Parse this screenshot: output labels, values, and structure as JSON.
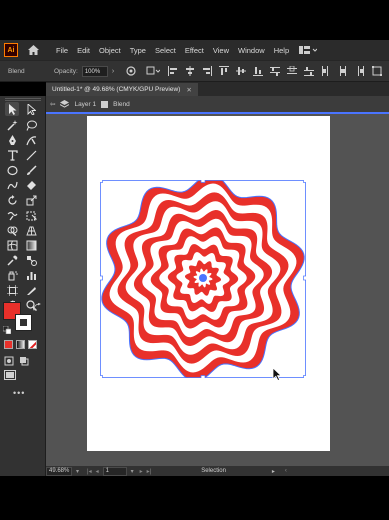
{
  "app": {
    "logo_text": "Ai"
  },
  "menu": [
    "File",
    "Edit",
    "Object",
    "Type",
    "Select",
    "Effect",
    "View",
    "Window",
    "Help"
  ],
  "control_bar": {
    "selection_type": "Blend",
    "opacity_label": "Opacity:",
    "opacity_value": "100%"
  },
  "document": {
    "tab_title": "Untitled-1* @ 49.68% (CMYK/GPU Preview)",
    "breadcrumb": [
      "Layer 1",
      "Blend"
    ]
  },
  "status": {
    "zoom": "49.68%",
    "artboard_number": "1",
    "mode": "Selection"
  },
  "colors": {
    "fill": "#e8302a",
    "stroke": "#ffffff",
    "selection": "#4a74ff",
    "app_bg": "#323232"
  },
  "icons": [
    "home-icon",
    "workspace-icon",
    "selection-tool-icon",
    "direct-selection-tool-icon",
    "pen-tool-icon",
    "type-tool-icon",
    "rectangle-tool-icon",
    "zoom-tool-icon",
    "hand-tool-icon"
  ]
}
